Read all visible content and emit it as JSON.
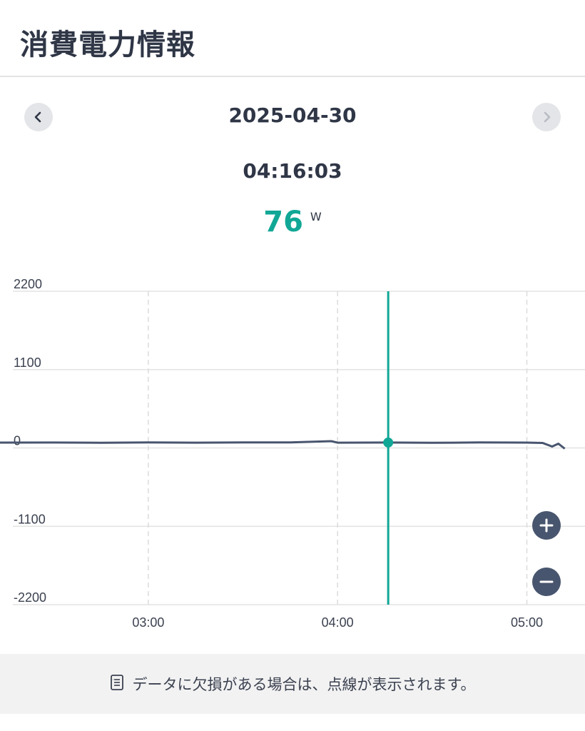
{
  "header": {
    "title": "消費電力情報"
  },
  "nav": {
    "prev_icon": "chevron-left-icon",
    "next_icon": "chevron-right-icon"
  },
  "selection": {
    "date": "2025-04-30",
    "time": "04:16:03",
    "value": "76",
    "unit": "W"
  },
  "colors": {
    "accent": "#11a796",
    "line": "#48556e",
    "grid": "#e3e3e3"
  },
  "chart_data": {
    "type": "line",
    "y_ticks": [
      "2200",
      "1100",
      "0",
      "-1100",
      "-2200"
    ],
    "ylim": [
      -2200,
      2200
    ],
    "x_ticks": [
      "03:00",
      "04:00",
      "05:00"
    ],
    "xlim": [
      "02:13",
      "05:13"
    ],
    "cursor_time": "04:16:03",
    "series": [
      {
        "values": [
          {
            "x": "02:13",
            "y": 75
          },
          {
            "x": "02:30",
            "y": 76
          },
          {
            "x": "02:45",
            "y": 73
          },
          {
            "x": "03:00",
            "y": 78
          },
          {
            "x": "03:15",
            "y": 74
          },
          {
            "x": "03:30",
            "y": 77
          },
          {
            "x": "03:45",
            "y": 78
          },
          {
            "x": "03:58",
            "y": 95
          },
          {
            "x": "04:00",
            "y": 74
          },
          {
            "x": "04:16",
            "y": 76
          },
          {
            "x": "04:30",
            "y": 72
          },
          {
            "x": "04:45",
            "y": 77
          },
          {
            "x": "05:00",
            "y": 75
          },
          {
            "x": "05:05",
            "y": 70
          },
          {
            "x": "05:08",
            "y": 20
          },
          {
            "x": "05:10",
            "y": 60
          },
          {
            "x": "05:12",
            "y": -10
          }
        ]
      }
    ],
    "grid": true
  },
  "zoom": {
    "in_icon": "plus-icon",
    "out_icon": "minus-icon"
  },
  "footer": {
    "icon": "document-icon",
    "note": "データに欠損がある場合は、点線が表示されます。"
  }
}
